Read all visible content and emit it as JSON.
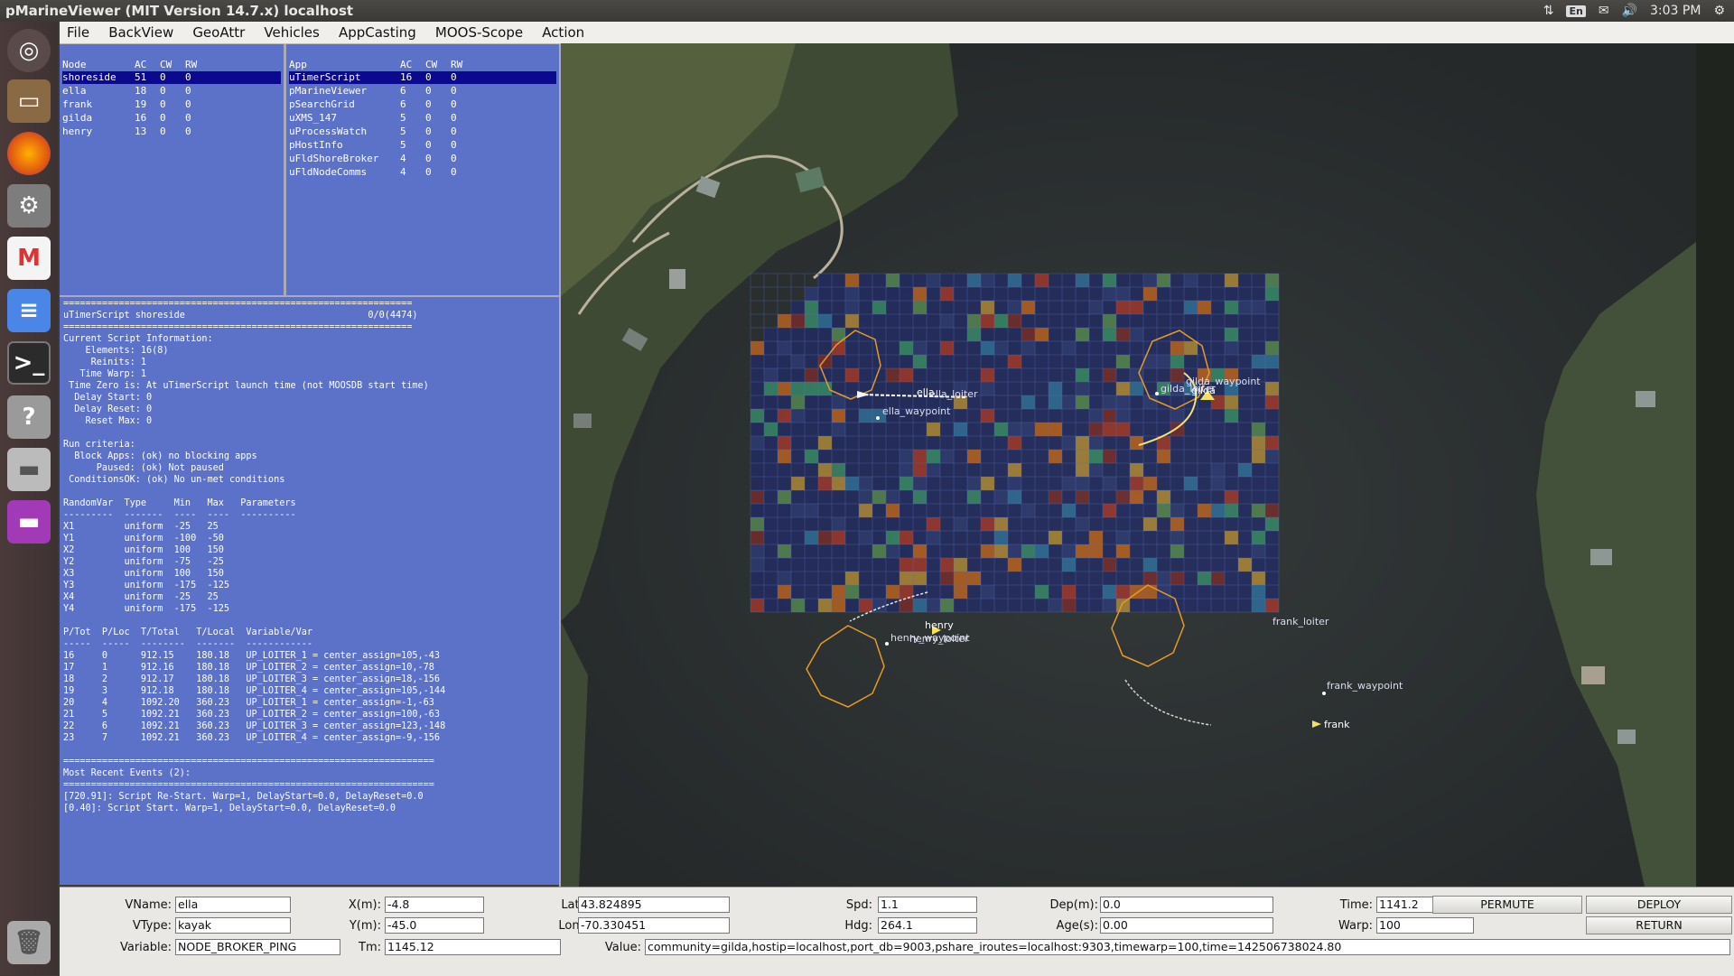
{
  "window": {
    "title": "pMarineViewer (MIT Version 14.7.x) localhost"
  },
  "tray": {
    "lang": "En",
    "time": "3:03 PM"
  },
  "menu": {
    "items": [
      "File",
      "BackView",
      "GeoAttr",
      "Vehicles",
      "AppCasting",
      "MOOS-Scope",
      "Action"
    ]
  },
  "nodes": {
    "headers": [
      "Node",
      "AC",
      "CW",
      "RW"
    ],
    "divider": [
      "---------",
      "--",
      "--",
      "--"
    ],
    "rows": [
      [
        "shoreside",
        "51",
        "0",
        "0"
      ],
      [
        "ella",
        "18",
        "0",
        "0"
      ],
      [
        "frank",
        "19",
        "0",
        "0"
      ],
      [
        "gilda",
        "16",
        "0",
        "0"
      ],
      [
        "henry",
        "13",
        "0",
        "0"
      ]
    ]
  },
  "apps": {
    "headers": [
      "App",
      "AC",
      "CW",
      "RW"
    ],
    "divider": [
      "----------------",
      "--",
      "--",
      "--"
    ],
    "rows": [
      [
        "uTimerScript",
        "16",
        "0",
        "0"
      ],
      [
        "pMarineViewer",
        "6",
        "0",
        "0"
      ],
      [
        "pSearchGrid",
        "6",
        "0",
        "0"
      ],
      [
        "uXMS_147",
        "5",
        "0",
        "0"
      ],
      [
        "uProcessWatch",
        "5",
        "0",
        "0"
      ],
      [
        "pHostInfo",
        "5",
        "0",
        "0"
      ],
      [
        "uFldShoreBroker",
        "4",
        "0",
        "0"
      ],
      [
        "uFldNodeComms",
        "4",
        "0",
        "0"
      ]
    ]
  },
  "script": {
    "lines": [
      "===============================================================",
      "uTimerScript shoreside                                 0/0(4474)",
      "===============================================================",
      "Current Script Information:",
      "    Elements: 16(8)",
      "     Reinits: 1",
      "   Time Warp: 1",
      " Time Zero is: At uTimerScript launch time (not MOOSDB start time)",
      "  Delay Start: 0",
      "  Delay Reset: 0",
      "    Reset Max: 0",
      "",
      "Run criteria:",
      "  Block Apps: (ok) no blocking apps",
      "      Paused: (ok) Not paused",
      " ConditionsOK: (ok) No un-met conditions",
      "",
      "RandomVar  Type     Min   Max   Parameters",
      "---------  -------  ----  ----  ----------",
      "X1         uniform  -25   25",
      "Y1         uniform  -100  -50",
      "X2         uniform  100   150",
      "Y2         uniform  -75   -25",
      "X3         uniform  100   150",
      "Y3         uniform  -175  -125",
      "X4         uniform  -25   25",
      "Y4         uniform  -175  -125",
      "",
      "P/Tot  P/Loc  T/Total   T/Local  Variable/Var",
      "-----  -----  --------  -------  ------------",
      "16     0      912.15    180.18   UP_LOITER_1 = center_assign=105,-43",
      "17     1      912.16    180.18   UP_LOITER_2 = center_assign=10,-78",
      "18     2      912.17    180.18   UP_LOITER_3 = center_assign=18,-156",
      "19     3      912.18    180.18   UP_LOITER_4 = center_assign=105,-144",
      "20     4      1092.20   360.23   UP_LOITER_1 = center_assign=-1,-63",
      "21     5      1092.21   360.23   UP_LOITER_2 = center_assign=100,-63",
      "22     6      1092.21   360.23   UP_LOITER_3 = center_assign=123,-148",
      "23     7      1092.21   360.23   UP_LOITER_4 = center_assign=-9,-156",
      "",
      "===================================================================",
      "Most Recent Events (2):",
      "===================================================================",
      "[720.91]: Script Re-Start. Warp=1, DelayStart=0.0, DelayReset=0.0",
      "[0.40]: Script Start. Warp=1, DelayStart=0.0, DelayReset=0.0"
    ]
  },
  "map": {
    "labels": {
      "ella": "ella",
      "ella_loiter": "ella_loiter",
      "ella_waypoint": "ella_waypoint",
      "gilda": "gilda",
      "gilda_loiter": "gilda_loiter",
      "gilda_waypoint": "gilda_waypoint",
      "henry": "henry",
      "henry_loiter": "henry_loiter",
      "henry_waypoint": "henry_waypoint",
      "frank": "frank",
      "frank_loiter": "frank_loiter",
      "frank_waypoint": "frank_waypoint"
    }
  },
  "bottom": {
    "vname_label": "VName:",
    "vname": "ella",
    "vtype_label": "VType:",
    "vtype": "kayak",
    "variable_label": "Variable:",
    "variable": "NODE_BROKER_PING",
    "x_label": "X(m):",
    "x": "-4.8",
    "y_label": "Y(m):",
    "y": "-45.0",
    "tm_label": "Tm:",
    "tm": "1145.12",
    "lat_label": "Lat:",
    "lat": "43.824895",
    "lon_label": "Lon:",
    "lon": "-70.330451",
    "value_label": "Value:",
    "value": "community=gilda,hostip=localhost,port_db=9003,pshare_iroutes=localhost:9303,timewarp=100,time=142506738024.80",
    "spd_label": "Spd:",
    "spd": "1.1",
    "hdg_label": "Hdg:",
    "hdg": "264.1",
    "dep_label": "Dep(m):",
    "dep": "0.0",
    "age_label": "Age(s):",
    "age": "0.00",
    "time_label": "Time:",
    "time": "1141.2",
    "warp_label": "Warp:",
    "warp": "100",
    "permute": "PERMUTE",
    "deploy": "DEPLOY",
    "return": "RETURN"
  }
}
